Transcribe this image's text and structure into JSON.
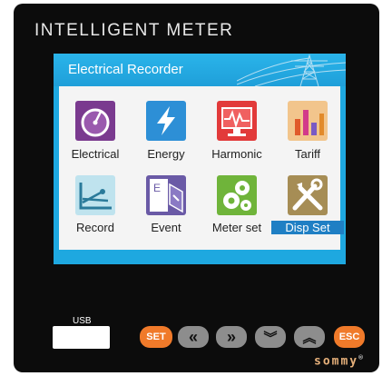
{
  "device": {
    "title": "INTELLIGENT METER",
    "brand": "sommy",
    "brand_mark": "®"
  },
  "screen": {
    "title": "Electrical Recorder",
    "items": [
      {
        "label": "Electrical",
        "icon": "gauge-icon",
        "color": "#7a3a8f",
        "selected": false
      },
      {
        "label": "Energy",
        "icon": "lightning-icon",
        "color": "#2d8fd6",
        "selected": false
      },
      {
        "label": "Harmonic",
        "icon": "waveform-icon",
        "color": "#e23a3a",
        "selected": false
      },
      {
        "label": "Tariff",
        "icon": "bar-chart-icon",
        "color": "#f2c58c",
        "selected": false
      },
      {
        "label": "Record",
        "icon": "line-chart-icon",
        "color": "#bfe3ee",
        "selected": false
      },
      {
        "label": "Event",
        "icon": "event-log-icon",
        "color": "#6a5aa6",
        "selected": false
      },
      {
        "label": "Meter set",
        "icon": "gears-icon",
        "color": "#6fb43a",
        "selected": false
      },
      {
        "label": "Disp Set",
        "icon": "tools-icon",
        "color": "#a68d55",
        "selected": true
      }
    ]
  },
  "controls": {
    "usb_label": "USB",
    "buttons": {
      "set": "SET",
      "left": "«",
      "right": "»",
      "down": "︾",
      "up": "︽",
      "esc": "ESC"
    }
  },
  "colors": {
    "screen_blue": "#1ea8e0",
    "selected_bg": "#1f7fc4",
    "orange_button": "#f07a2a",
    "gray_button": "#8d8d8d"
  }
}
